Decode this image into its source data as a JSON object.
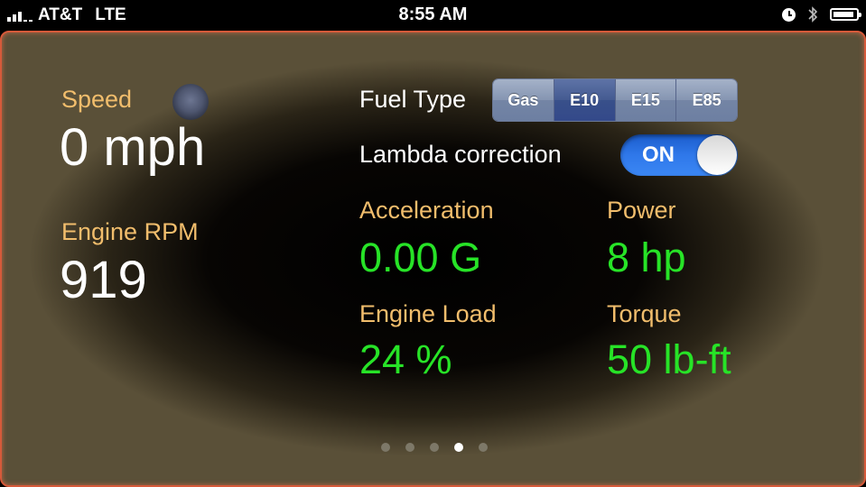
{
  "status_bar": {
    "carrier": "AT&T",
    "network": "LTE",
    "time": "8:55 AM",
    "icons": [
      "signal-icon",
      "alarm-clock-icon",
      "bluetooth-icon",
      "battery-icon"
    ],
    "battery_level": 0.9
  },
  "speed": {
    "label": "Speed",
    "value": "0 mph"
  },
  "rpm": {
    "label": "Engine RPM",
    "value": "919"
  },
  "fuel_type": {
    "label": "Fuel Type",
    "options": [
      "Gas",
      "E10",
      "E15",
      "E85"
    ],
    "selected": "E10"
  },
  "lambda": {
    "label": "Lambda correction",
    "toggle_text": "ON",
    "on": true
  },
  "acceleration": {
    "label": "Acceleration",
    "value": "0.00 G"
  },
  "power": {
    "label": "Power",
    "value": "8 hp"
  },
  "engine_load": {
    "label": "Engine Load",
    "value": "24 %"
  },
  "torque": {
    "label": "Torque",
    "value": "50 lb-ft"
  },
  "page_indicator": {
    "count": 5,
    "current": 4
  },
  "colors": {
    "label_orange": "#f1bd6c",
    "value_green": "#27e327",
    "border": "#d65a3a",
    "toggle_blue": "#2f78ea"
  }
}
